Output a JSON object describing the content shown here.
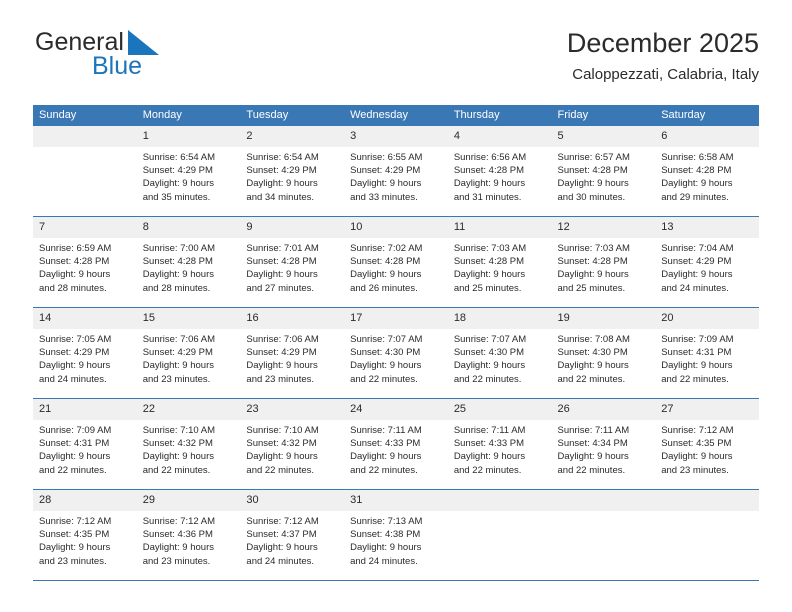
{
  "brand": {
    "name_part1": "General",
    "name_part2": "Blue",
    "logo_icon": "blue-triangle-mark",
    "accent_color": "#1b75bc"
  },
  "header": {
    "title": "December 2025",
    "subtitle": "Caloppezzati, Calabria, Italy"
  },
  "calendar": {
    "header_bg": "#3a77b5",
    "daynum_bg": "#f0f0f0",
    "weekday_headers": [
      "Sunday",
      "Monday",
      "Tuesday",
      "Wednesday",
      "Thursday",
      "Friday",
      "Saturday"
    ],
    "weeks": [
      [
        {
          "day": "",
          "lines": []
        },
        {
          "day": "1",
          "lines": [
            "Sunrise: 6:54 AM",
            "Sunset: 4:29 PM",
            "Daylight: 9 hours",
            "and 35 minutes."
          ]
        },
        {
          "day": "2",
          "lines": [
            "Sunrise: 6:54 AM",
            "Sunset: 4:29 PM",
            "Daylight: 9 hours",
            "and 34 minutes."
          ]
        },
        {
          "day": "3",
          "lines": [
            "Sunrise: 6:55 AM",
            "Sunset: 4:29 PM",
            "Daylight: 9 hours",
            "and 33 minutes."
          ]
        },
        {
          "day": "4",
          "lines": [
            "Sunrise: 6:56 AM",
            "Sunset: 4:28 PM",
            "Daylight: 9 hours",
            "and 31 minutes."
          ]
        },
        {
          "day": "5",
          "lines": [
            "Sunrise: 6:57 AM",
            "Sunset: 4:28 PM",
            "Daylight: 9 hours",
            "and 30 minutes."
          ]
        },
        {
          "day": "6",
          "lines": [
            "Sunrise: 6:58 AM",
            "Sunset: 4:28 PM",
            "Daylight: 9 hours",
            "and 29 minutes."
          ]
        }
      ],
      [
        {
          "day": "7",
          "lines": [
            "Sunrise: 6:59 AM",
            "Sunset: 4:28 PM",
            "Daylight: 9 hours",
            "and 28 minutes."
          ]
        },
        {
          "day": "8",
          "lines": [
            "Sunrise: 7:00 AM",
            "Sunset: 4:28 PM",
            "Daylight: 9 hours",
            "and 28 minutes."
          ]
        },
        {
          "day": "9",
          "lines": [
            "Sunrise: 7:01 AM",
            "Sunset: 4:28 PM",
            "Daylight: 9 hours",
            "and 27 minutes."
          ]
        },
        {
          "day": "10",
          "lines": [
            "Sunrise: 7:02 AM",
            "Sunset: 4:28 PM",
            "Daylight: 9 hours",
            "and 26 minutes."
          ]
        },
        {
          "day": "11",
          "lines": [
            "Sunrise: 7:03 AM",
            "Sunset: 4:28 PM",
            "Daylight: 9 hours",
            "and 25 minutes."
          ]
        },
        {
          "day": "12",
          "lines": [
            "Sunrise: 7:03 AM",
            "Sunset: 4:28 PM",
            "Daylight: 9 hours",
            "and 25 minutes."
          ]
        },
        {
          "day": "13",
          "lines": [
            "Sunrise: 7:04 AM",
            "Sunset: 4:29 PM",
            "Daylight: 9 hours",
            "and 24 minutes."
          ]
        }
      ],
      [
        {
          "day": "14",
          "lines": [
            "Sunrise: 7:05 AM",
            "Sunset: 4:29 PM",
            "Daylight: 9 hours",
            "and 24 minutes."
          ]
        },
        {
          "day": "15",
          "lines": [
            "Sunrise: 7:06 AM",
            "Sunset: 4:29 PM",
            "Daylight: 9 hours",
            "and 23 minutes."
          ]
        },
        {
          "day": "16",
          "lines": [
            "Sunrise: 7:06 AM",
            "Sunset: 4:29 PM",
            "Daylight: 9 hours",
            "and 23 minutes."
          ]
        },
        {
          "day": "17",
          "lines": [
            "Sunrise: 7:07 AM",
            "Sunset: 4:30 PM",
            "Daylight: 9 hours",
            "and 22 minutes."
          ]
        },
        {
          "day": "18",
          "lines": [
            "Sunrise: 7:07 AM",
            "Sunset: 4:30 PM",
            "Daylight: 9 hours",
            "and 22 minutes."
          ]
        },
        {
          "day": "19",
          "lines": [
            "Sunrise: 7:08 AM",
            "Sunset: 4:30 PM",
            "Daylight: 9 hours",
            "and 22 minutes."
          ]
        },
        {
          "day": "20",
          "lines": [
            "Sunrise: 7:09 AM",
            "Sunset: 4:31 PM",
            "Daylight: 9 hours",
            "and 22 minutes."
          ]
        }
      ],
      [
        {
          "day": "21",
          "lines": [
            "Sunrise: 7:09 AM",
            "Sunset: 4:31 PM",
            "Daylight: 9 hours",
            "and 22 minutes."
          ]
        },
        {
          "day": "22",
          "lines": [
            "Sunrise: 7:10 AM",
            "Sunset: 4:32 PM",
            "Daylight: 9 hours",
            "and 22 minutes."
          ]
        },
        {
          "day": "23",
          "lines": [
            "Sunrise: 7:10 AM",
            "Sunset: 4:32 PM",
            "Daylight: 9 hours",
            "and 22 minutes."
          ]
        },
        {
          "day": "24",
          "lines": [
            "Sunrise: 7:11 AM",
            "Sunset: 4:33 PM",
            "Daylight: 9 hours",
            "and 22 minutes."
          ]
        },
        {
          "day": "25",
          "lines": [
            "Sunrise: 7:11 AM",
            "Sunset: 4:33 PM",
            "Daylight: 9 hours",
            "and 22 minutes."
          ]
        },
        {
          "day": "26",
          "lines": [
            "Sunrise: 7:11 AM",
            "Sunset: 4:34 PM",
            "Daylight: 9 hours",
            "and 22 minutes."
          ]
        },
        {
          "day": "27",
          "lines": [
            "Sunrise: 7:12 AM",
            "Sunset: 4:35 PM",
            "Daylight: 9 hours",
            "and 23 minutes."
          ]
        }
      ],
      [
        {
          "day": "28",
          "lines": [
            "Sunrise: 7:12 AM",
            "Sunset: 4:35 PM",
            "Daylight: 9 hours",
            "and 23 minutes."
          ]
        },
        {
          "day": "29",
          "lines": [
            "Sunrise: 7:12 AM",
            "Sunset: 4:36 PM",
            "Daylight: 9 hours",
            "and 23 minutes."
          ]
        },
        {
          "day": "30",
          "lines": [
            "Sunrise: 7:12 AM",
            "Sunset: 4:37 PM",
            "Daylight: 9 hours",
            "and 24 minutes."
          ]
        },
        {
          "day": "31",
          "lines": [
            "Sunrise: 7:13 AM",
            "Sunset: 4:38 PM",
            "Daylight: 9 hours",
            "and 24 minutes."
          ]
        },
        {
          "day": "",
          "lines": []
        },
        {
          "day": "",
          "lines": []
        },
        {
          "day": "",
          "lines": []
        }
      ]
    ]
  }
}
